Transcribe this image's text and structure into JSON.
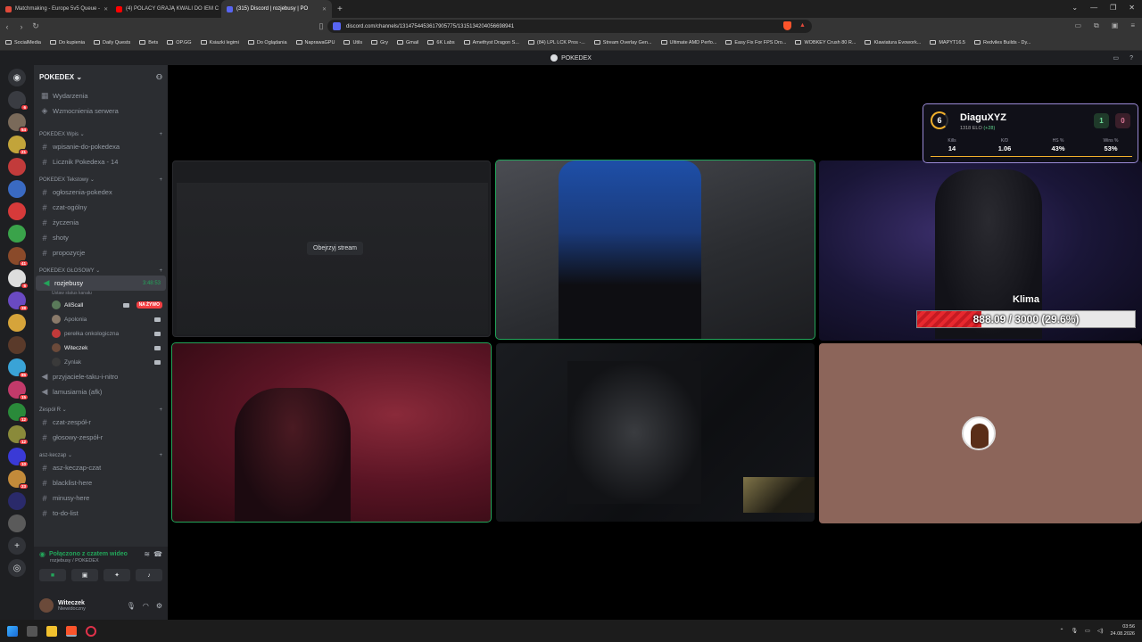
{
  "browser": {
    "tabs": [
      {
        "title": "Matchmaking - Europe 5v5 Queue -",
        "color": "#e04a3a"
      },
      {
        "title": "(4) POLACY GRAJĄ KWALI DO IEM C",
        "color": "#ff0000"
      },
      {
        "title": "(315) Discord | rozjebusy | PO",
        "color": "#5865f2"
      }
    ],
    "url": "discord.com/channels/1314754453617905775/1315134204056698941",
    "bookmarks": [
      "SocialMedia",
      "Do kupienia",
      "Daily Quests",
      "Bets",
      "OP.GG",
      "Ksiazki legimi",
      "Do Oglądania",
      "NaprawaGPU",
      "Utils",
      "Gry",
      "Gmail",
      "6K Labs",
      "Amethyst Dragon S...",
      "(84) LPL LCK Pros -...",
      "Stream Overlay Gen...",
      "Ultimate AMD Perfo...",
      "Easy Fix For FPS Dro...",
      "WOBKEY Crush 80 R...",
      "Klawiatura Evowork...",
      "MAPYT16.5",
      "Redviles Builds - Dy..."
    ]
  },
  "discord": {
    "window_title": "POKEDEX",
    "server_badges": [
      "6",
      "54",
      "21",
      "",
      "",
      "",
      "",
      "41",
      "6",
      "38",
      "",
      "",
      "85",
      "15",
      "12",
      "12",
      "10",
      "23",
      "",
      "",
      ""
    ],
    "server_colors": [
      "#3a3c42",
      "#7a6a5a",
      "#c2a43a",
      "#c23b3b",
      "#3a6ac2",
      "#d63a3a",
      "#3aa34a",
      "#8a4a2a",
      "#dddddd",
      "#6a4ac2",
      "#d6a43a",
      "#5a3a2a",
      "#3aa3d6",
      "#c23a6a",
      "#2a8a3a",
      "#8a8a3a",
      "#3a3ad6",
      "#c28a3a",
      "#2a2a6a",
      "#5a5a5a"
    ],
    "guild_name": "POKEDEX",
    "top_items": [
      {
        "label": "Wydarzenia",
        "icon": "calendar-icon"
      },
      {
        "label": "Wzmocnienia serwera",
        "icon": "boost-icon"
      }
    ],
    "categories": [
      {
        "name": "POKEDEX Wpis",
        "channels": [
          "wpisanie-do-pokedexa",
          "Licznik Pokedexa - 14"
        ]
      },
      {
        "name": "POKEDEX Tekstowy",
        "channels": [
          "ogłoszenia-pokedex",
          "czat-ogólny",
          "życzenia",
          "shoty",
          "propozycje"
        ]
      },
      {
        "name": "POKEDEX GŁOSOWY",
        "channels": []
      }
    ],
    "voice_channel": {
      "name": "rozjebusy",
      "timer": "3:48:53",
      "status_hint": "Ustaw status kanału",
      "users": [
        {
          "name": "AliScall",
          "live": "NA ŻYWO",
          "color": "#5a7a5a"
        },
        {
          "name": "Apolonia",
          "live": "",
          "color": "#8a7a6a"
        },
        {
          "name": "perełka onkologiczna",
          "live": "",
          "color": "#c23a3a"
        },
        {
          "name": "Witeczek",
          "live": "",
          "color": "#6b4a3a"
        },
        {
          "name": "Zynlak",
          "live": "",
          "color": "#3a3a3a"
        }
      ]
    },
    "voice_more": [
      "przyjaciele-taku-i-nitro",
      "lamusiarnia (afk)"
    ],
    "categories2": [
      {
        "name": "Zespół R",
        "channels": [
          "czat-zespół-r",
          "głosowy-zespół-r"
        ]
      },
      {
        "name": "asz-keczap",
        "channels": [
          "asz-keczap-czat",
          "blacklist-here",
          "minusy-here",
          "to-do-list"
        ]
      }
    ],
    "voice_panel": {
      "status": "Połączono z czatem wideo",
      "location": "rozjebusy / POKEDEX"
    },
    "user": {
      "name": "Witeczek",
      "status": "Niewidoczny"
    },
    "stage": {
      "watch_button": "Obejrzyj stream"
    }
  },
  "overlay": {
    "level": "6",
    "name": "DiaguXYZ",
    "elo": "1318 ELO",
    "elo_delta": "(+28)",
    "score_left": "1",
    "score_right": "0",
    "stats": [
      {
        "label": "Kills",
        "value": "14"
      },
      {
        "label": "K/D",
        "value": "1.06"
      },
      {
        "label": "HS %",
        "value": "43%"
      },
      {
        "label": "Wins %",
        "value": "53%"
      }
    ]
  },
  "goal": {
    "name": "Klima",
    "text": "888.09 / 3000 (29.6%)",
    "progress": 0.296
  },
  "taskbar": {
    "time": "03:56",
    "date": "24.08.2026"
  }
}
